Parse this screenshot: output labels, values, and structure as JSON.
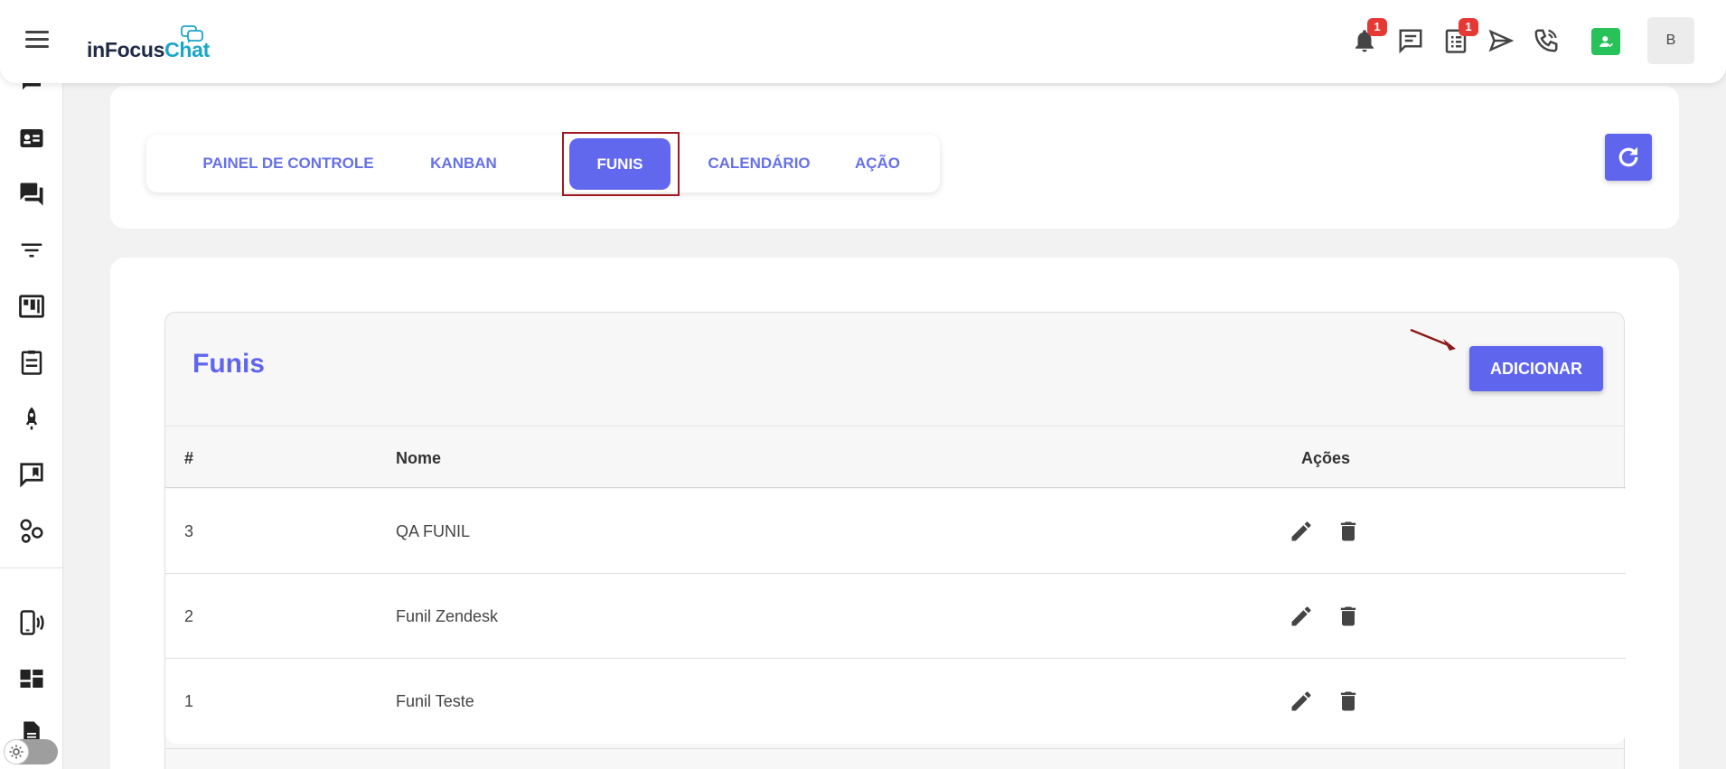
{
  "app": {
    "logo_part1": "inFocus",
    "logo_part2": "Chat"
  },
  "header": {
    "notifications_badge": "1",
    "tasks_badge": "1",
    "avatar_initial": "B",
    "icons": [
      "menu-icon",
      "bell-icon",
      "chat-bubble-icon",
      "clipboard-list-icon",
      "send-icon",
      "phone-icon",
      "user-status-icon"
    ]
  },
  "sidebar": {
    "icons": [
      "chat-icon",
      "contact-card-icon",
      "forum-icon",
      "filter-icon",
      "kanban-icon",
      "clipboard-icon",
      "rocket-icon",
      "message-flag-icon",
      "integrations-icon",
      "phone-device-icon",
      "dashboard-icon",
      "document-icon",
      "theme-toggle-icon"
    ]
  },
  "tabs": [
    {
      "label": "PAINEL DE CONTROLE"
    },
    {
      "label": "KANBAN"
    },
    {
      "label": "FUNIS"
    },
    {
      "label": "CALENDÁRIO"
    },
    {
      "label": "AÇÃO"
    }
  ],
  "active_tab": "FUNIS",
  "funis": {
    "title": "Funis",
    "add_label": "ADICIONAR",
    "columns": {
      "id": "#",
      "name": "Nome",
      "actions": "Ações"
    },
    "rows": [
      {
        "id": "3",
        "name": "QA FUNIL"
      },
      {
        "id": "2",
        "name": "Funil Zendesk"
      },
      {
        "id": "1",
        "name": "Funil Teste"
      }
    ]
  },
  "colors": {
    "accent": "#5f65ec",
    "badge": "#e53935",
    "status_green": "#27c25a",
    "highlight_frame": "#a01822"
  }
}
